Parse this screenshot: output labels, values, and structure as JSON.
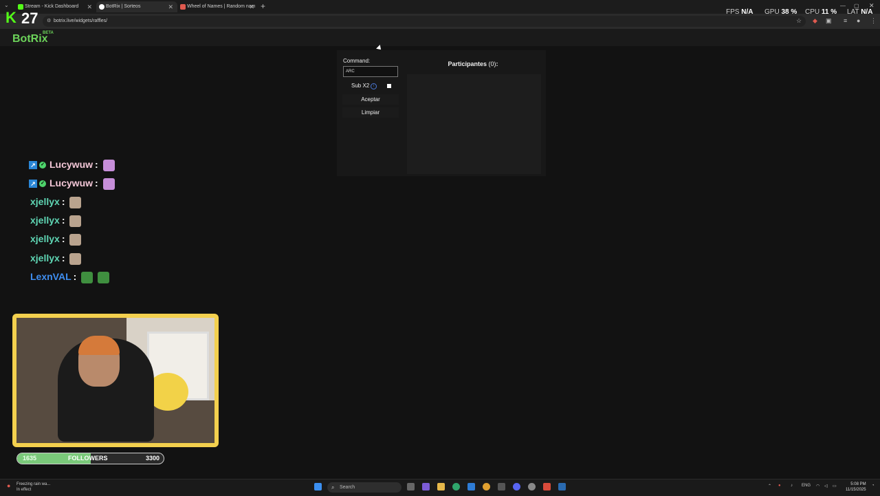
{
  "browser": {
    "tabs": [
      {
        "title": "Stream - Kick Dashboard",
        "active": false,
        "favicon_color": "#53fc18"
      },
      {
        "title": "BotRix | Sorteos",
        "active": true,
        "favicon_color": "#ffffff"
      },
      {
        "title": "Wheel of Names | Random nam",
        "active": false,
        "favicon_color": "#e05a4f"
      }
    ],
    "url": "botrix.live/widgets/raffles/"
  },
  "overlay": {
    "kick_logo": "K",
    "viewer_count": "27",
    "fps_label": "FPS",
    "fps_value": "N/A",
    "gpu_label": "GPU",
    "gpu_value": "38 %",
    "cpu_label": "CPU",
    "cpu_value": "11 %",
    "lat_label": "LAT",
    "lat_value": "N/A"
  },
  "app": {
    "brand": "BotRix",
    "beta": "BETA",
    "command_label": "Command:",
    "command_value": "ARC",
    "sub_label": "Sub X2",
    "accept_label": "Aceptar",
    "clear_label": "Limpiar",
    "participants_title": "Participantes",
    "participants_count": "(0)",
    "participants_colon": ":"
  },
  "chat": [
    {
      "user": "Lucywuw",
      "color": "pink",
      "badges": true
    },
    {
      "user": "Lucywuw",
      "color": "pink",
      "badges": true
    },
    {
      "user": "xjellyx",
      "color": "teal",
      "badges": false
    },
    {
      "user": "xjellyx",
      "color": "teal",
      "badges": false
    },
    {
      "user": "xjellyx",
      "color": "teal",
      "badges": false
    },
    {
      "user": "xjellyx",
      "color": "teal",
      "badges": false
    },
    {
      "user": "LexnVAL",
      "color": "blue",
      "badges": false
    }
  ],
  "followers": {
    "current": "1635",
    "label": "FOLLOWERS",
    "goal": "3300",
    "progress": 0.5
  },
  "taskbar": {
    "weather": "Freezing rain wa...",
    "weather_sub": "In effect",
    "search_placeholder": "Search",
    "lang": "ENG",
    "time": "5:08 PM",
    "date": "11/15/2025"
  }
}
